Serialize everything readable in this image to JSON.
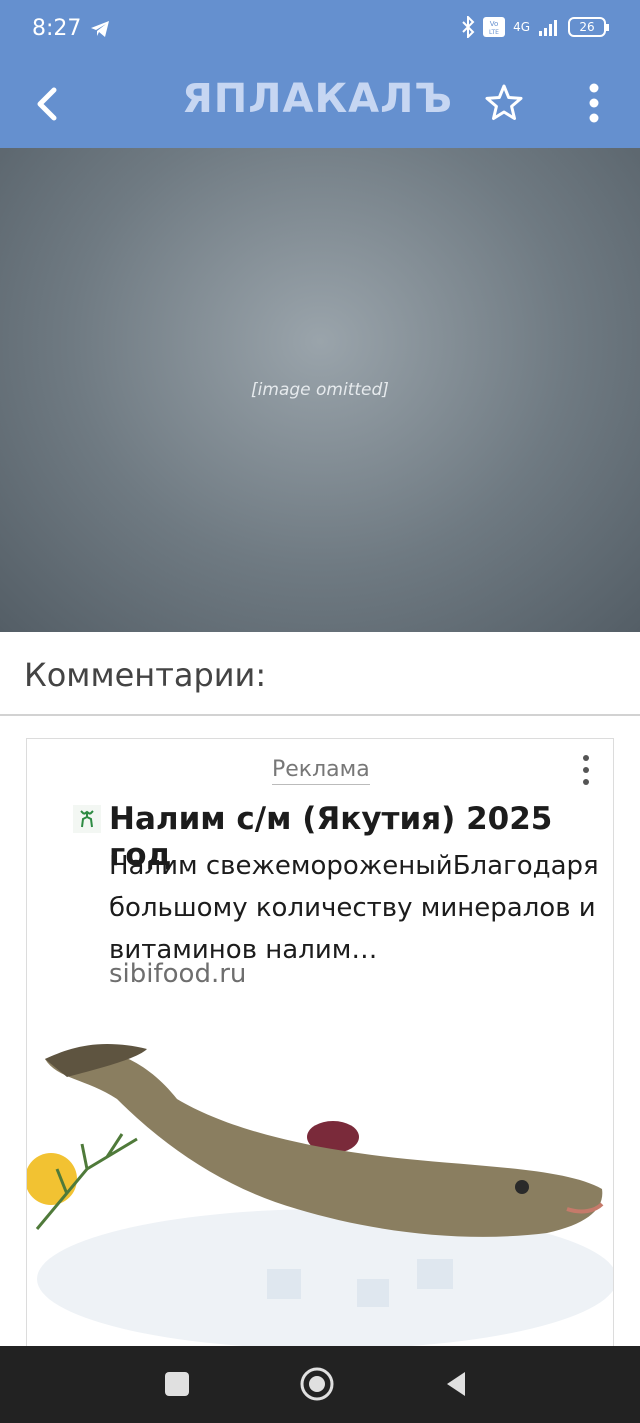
{
  "status_bar": {
    "time": "8:27",
    "network": "4G",
    "battery": "26",
    "icons": [
      "telegram-icon",
      "bluetooth-icon",
      "volte-icon",
      "signal-icon",
      "battery-icon"
    ]
  },
  "app_bar": {
    "logo": "ЯПЛАКАЛЪ",
    "icons": [
      "back-arrow-icon",
      "star-icon",
      "more-vertical-icon"
    ]
  },
  "post": {
    "image_caption": "[image omitted]"
  },
  "comments": {
    "heading": "Комментарии:"
  },
  "ad": {
    "label": "Реклама",
    "title": "Налим с/м (Якутия) 2025 год",
    "description": "Налим свежемороженыйБлагодаря большому количеству минералов и витаминов налим…",
    "domain": "sibifood.ru",
    "favicon_icon": "deer-icon",
    "image_icon": "fish-image"
  },
  "nav_bar": {
    "icons": [
      "recents-square-icon",
      "home-circle-icon",
      "back-triangle-icon"
    ]
  },
  "colors": {
    "app_blue": "#6590cf",
    "nav_dark": "#222222"
  }
}
